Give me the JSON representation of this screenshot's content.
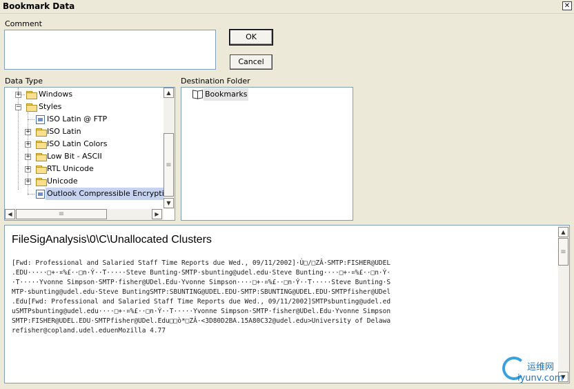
{
  "window": {
    "title": "Bookmark Data",
    "close_glyph": "✕"
  },
  "comment": {
    "label": "Comment",
    "value": ""
  },
  "buttons": {
    "ok": "OK",
    "cancel": "Cancel"
  },
  "data_type": {
    "label": "Data Type",
    "items": [
      {
        "label": "Windows",
        "icon": "folder-icon",
        "expander": "+"
      },
      {
        "label": "Styles",
        "icon": "folder-open-icon",
        "expander": "−"
      },
      {
        "label": "ISO Latin @ FTP",
        "icon": "document-icon",
        "expander": ""
      },
      {
        "label": "ISO Latin",
        "icon": "folder-icon",
        "expander": "+"
      },
      {
        "label": "ISO Latin Colors",
        "icon": "folder-icon",
        "expander": "+"
      },
      {
        "label": "Low Bit - ASCII",
        "icon": "folder-icon",
        "expander": "+"
      },
      {
        "label": "RTL Unicode",
        "icon": "folder-icon",
        "expander": "+"
      },
      {
        "label": "Unicode",
        "icon": "folder-icon",
        "expander": "+"
      },
      {
        "label": "Outlook Compressible Encryption fo",
        "icon": "document-icon",
        "expander": "",
        "selected": true
      }
    ]
  },
  "destination": {
    "label": "Destination Folder",
    "root": "Bookmarks"
  },
  "content": {
    "path": "FileSigAnalysis\\0\\C\\Unallocated Clusters",
    "lines": [
      "[Fwd: Professional and Salaried Staff Time Reports due Wed., 09/11/2002]·Ù□/□ZÂ·SMTP:FISHER@UDEL",
      ".EDU·····□+·¤%£··□n·Ý··T·····Steve Bunting·SMTP·sbunting@udel.edu·Steve Bunting····□+·¤%£··□n·Ý·",
      "·T·····Yvonne Simpson·SMTP·fisher@UDel.Edu·Yvonne Simpson····□+·¤%£··□n·Ý··T·····Steve Bunting·S",
      "MTP·sbunting@udel.edu·Steve BuntingSMTP:SBUNTING@UDEL.EDU·SMTP:SBUNTING@UDEL.EDU·SMTPfisher@UDel",
      ".Edu[Fwd: Professional and Salaried Staff Time Reports due Wed., 09/11/2002]SMTPsbunting@udel.ed",
      "uSMTPsbunting@udel.edu····□+·¤%£··□n·Ý··T·····Yvonne Simpson·SMTP·fisher@UDel.Edu·Yvonne Simpson",
      "SMTP:FISHER@UDEL.EDU·SMTPfisher@UDel.Edu□□ò*□ZÂ·<3D80D2BA.15A80C32@udel.edu>University of Delawa",
      "refisher@copland.udel.eduenMozilla 4.77"
    ]
  },
  "watermark": {
    "brand": "运维网",
    "domain": "iyunv.com"
  },
  "scroll_glyphs": {
    "up": "▲",
    "down": "▼",
    "left": "◀",
    "right": "▶",
    "grip": "≡"
  }
}
